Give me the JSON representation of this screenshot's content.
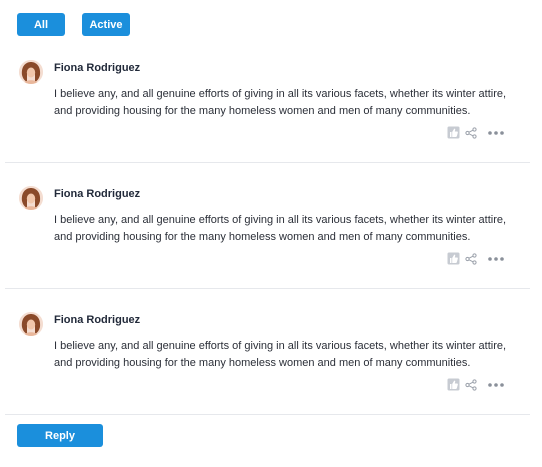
{
  "filters": {
    "all_label": "All",
    "active_label": "Active"
  },
  "comments": [
    {
      "author": "Fiona Rodriguez",
      "text": "I believe any, and all genuine efforts of giving in all its various facets, whether its winter attire, and providing housing for the many homeless women and men of many communities."
    },
    {
      "author": "Fiona Rodriguez",
      "text": "I believe any, and all genuine efforts of giving in all its various facets, whether its winter attire, and providing housing for the many homeless women and men of many communities."
    },
    {
      "author": "Fiona Rodriguez",
      "text": "I believe any, and all genuine efforts of giving in all its various facets, whether its winter attire, and providing housing for the many homeless women and men of many communities."
    }
  ],
  "actions": {
    "reply_label": "Reply"
  },
  "icons": {
    "like": "thumbs-up-icon",
    "share": "share-icon",
    "more": "more-dots-icon"
  },
  "colors": {
    "accent": "#1b8fdc",
    "icon": "#9aa0aa",
    "divider": "#e6e8ec"
  }
}
